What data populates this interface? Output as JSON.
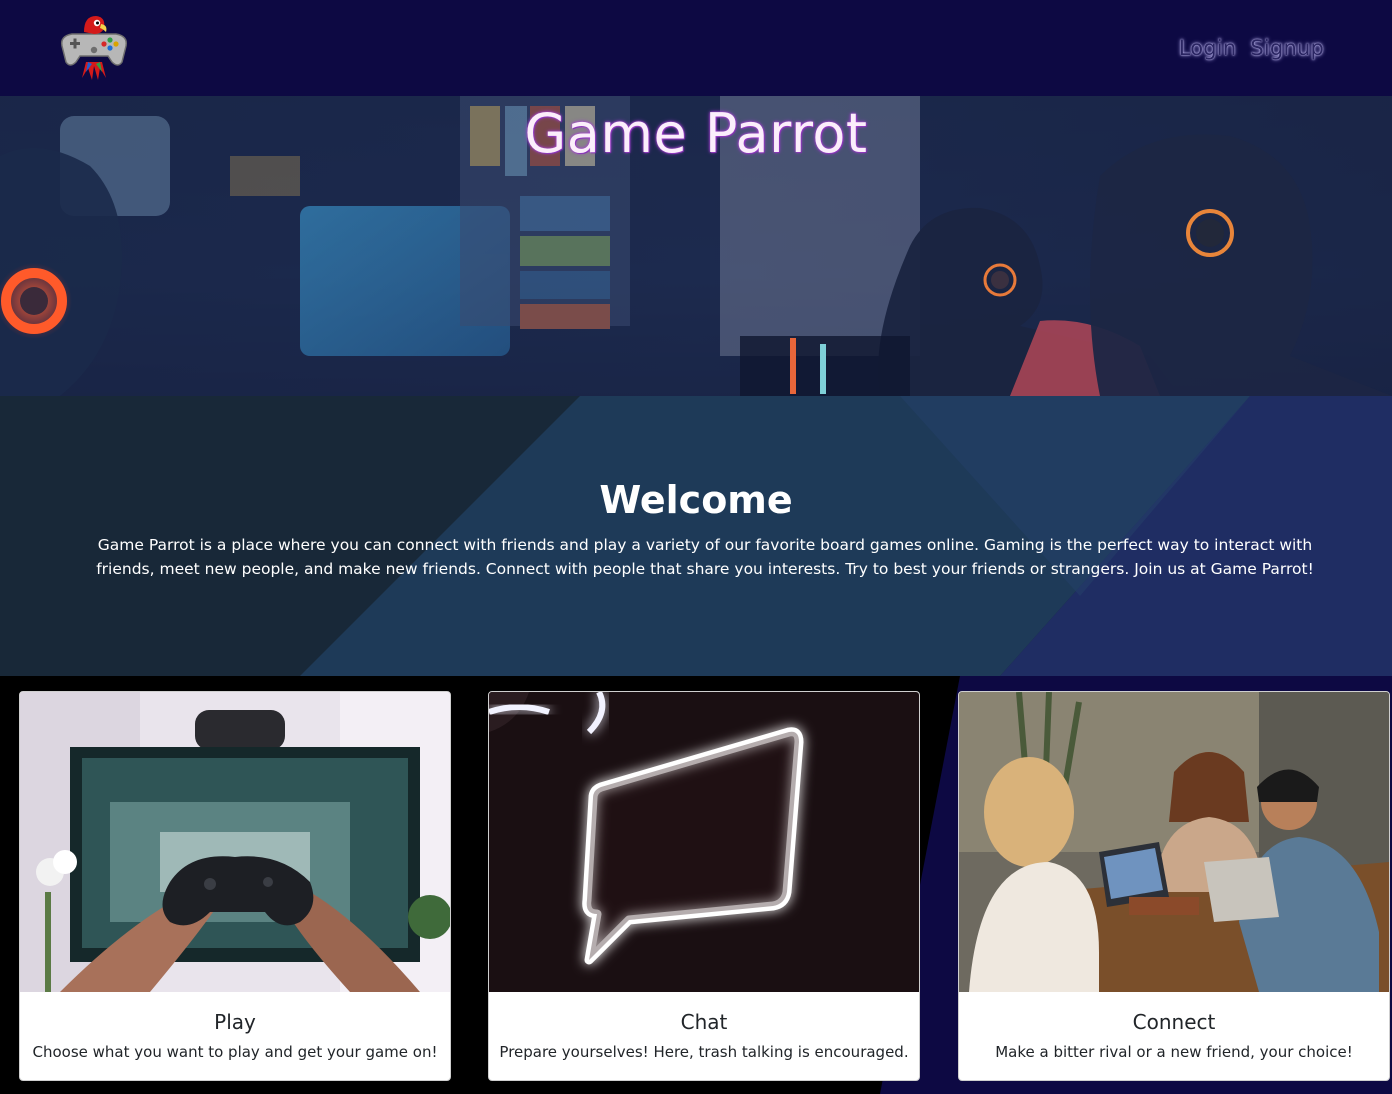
{
  "nav": {
    "logo_alt": "Game Parrot logo",
    "links": [
      {
        "label": "Login"
      },
      {
        "label": "Signup"
      }
    ]
  },
  "hero": {
    "title": "Game Parrot"
  },
  "welcome": {
    "title": "Welcome",
    "text": "Game Parrot is a place where you can connect with friends and play a variety of our favorite board games online. Gaming is the perfect way to interact with friends, meet new people, and make new friends. Connect with people that share you interests. Try to best your friends or strangers. Join us at Game Parrot!"
  },
  "cards": [
    {
      "title": "Play",
      "text": "Choose what you want to play and get your game on!"
    },
    {
      "title": "Chat",
      "text": "Prepare yourselves! Here, trash talking is encouraged."
    },
    {
      "title": "Connect",
      "text": "Make a bitter rival or a new friend, your choice!"
    }
  ],
  "colors": {
    "navbar": "#0d0943",
    "welcome_bg": "#182838",
    "accent_glow": "#9c3ad1"
  }
}
